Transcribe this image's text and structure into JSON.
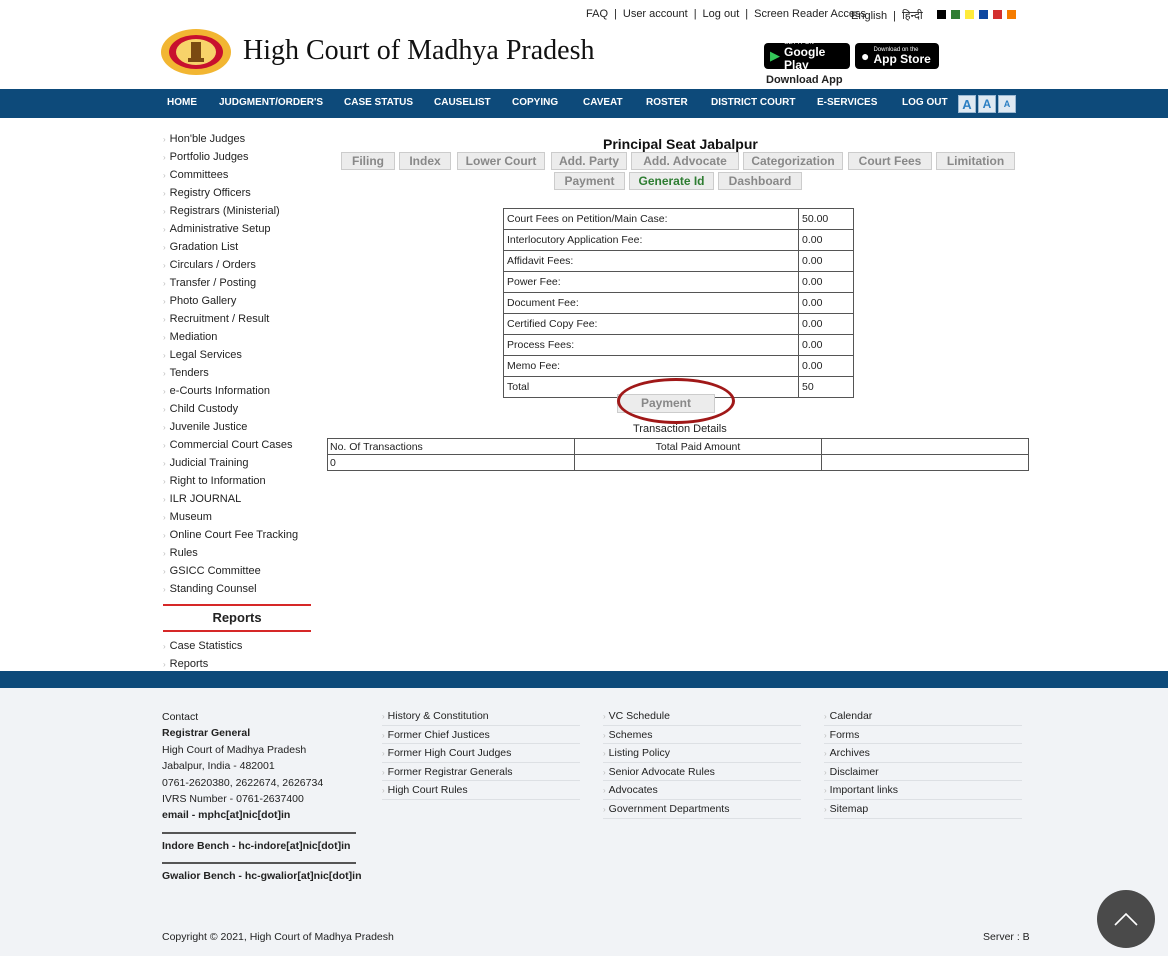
{
  "topbar": {
    "links": [
      "FAQ",
      "User account",
      "Log out",
      "Screen Reader Access"
    ],
    "lang_english": "English",
    "lang_hindi": "हिन्दी",
    "theme_swatches": [
      "#000000",
      "#2e7d32",
      "#ffeb3b",
      "#0d47a1",
      "#d32f2f",
      "#f57c00"
    ]
  },
  "header": {
    "title": "High Court of Madhya Pradesh",
    "google_play_small": "GET IT ON",
    "google_play_big": "Google Play",
    "app_store_small": "Download on the",
    "app_store_big": "App Store",
    "download_label": "Download App"
  },
  "nav": {
    "items": [
      "HOME",
      "JUDGMENT/ORDER'S",
      "CASE STATUS",
      "CAUSELIST",
      "COPYING",
      "CAVEAT",
      "ROSTER",
      "DISTRICT COURT",
      "E-SERVICES",
      "LOG OUT"
    ],
    "font_buttons": [
      "A",
      "A",
      "A"
    ]
  },
  "sidebar": {
    "items": [
      "Hon'ble Judges",
      "Portfolio Judges",
      "Committees",
      "Registry Officers",
      "Registrars (Ministerial)",
      "Administrative Setup",
      "Gradation List",
      "Circulars / Orders",
      "Transfer / Posting",
      "Photo Gallery",
      "Recruitment / Result",
      "Mediation",
      "Legal Services",
      "Tenders",
      "e-Courts Information",
      "Child Custody",
      "Juvenile Justice",
      "Commercial Court Cases",
      "Judicial Training",
      "Right to Information",
      "ILR JOURNAL",
      "Museum",
      "Online Court Fee Tracking",
      "Rules",
      "GSICC Committee",
      "Standing Counsel"
    ],
    "reports_heading": "Reports",
    "report_items": [
      "Case Statistics",
      "Reports"
    ]
  },
  "main": {
    "title": "Principal Seat Jabalpur",
    "tabs": [
      "Filing",
      "Index",
      "Lower Court",
      "Add. Party",
      "Add. Advocate",
      "Categorization",
      "Court Fees",
      "Limitation",
      "Payment",
      "Generate Id",
      "Dashboard"
    ],
    "fees": [
      {
        "label": "Court Fees on Petition/Main Case:",
        "value": "50.00"
      },
      {
        "label": "Interlocutory Application Fee:",
        "value": "0.00"
      },
      {
        "label": "Affidavit Fees:",
        "value": "0.00"
      },
      {
        "label": "Power Fee:",
        "value": "0.00"
      },
      {
        "label": "Document Fee:",
        "value": "0.00"
      },
      {
        "label": "Certified Copy Fee:",
        "value": "0.00"
      },
      {
        "label": "Process Fees:",
        "value": "0.00"
      },
      {
        "label": "Memo Fee:",
        "value": "0.00"
      },
      {
        "label": "Total",
        "value": "50"
      }
    ],
    "payment_button": "Payment",
    "transaction_title": "Transaction Details",
    "tx_headers": [
      "No. Of Transactions",
      "Total Paid Amount"
    ],
    "tx_row": [
      "0",
      ""
    ]
  },
  "footer": {
    "contact_label": "Contact",
    "registrar": "Registrar General",
    "address1": "High Court of Madhya Pradesh",
    "address2": "Jabalpur, India - 482001",
    "phones": "0761-2620380, 2622674, 2626734",
    "ivrs": "IVRS Number - 0761-2637400",
    "email": "email - mphc[at]nic[dot]in",
    "indore": "Indore Bench - hc-indore[at]nic[dot]in",
    "gwalior": "Gwalior Bench - hc-gwalior[at]nic[dot]in",
    "col1": [
      "History & Constitution",
      "Former Chief Justices",
      "Former High Court Judges",
      "Former Registrar Generals",
      "High Court Rules"
    ],
    "col2": [
      "VC Schedule",
      "Schemes",
      "Listing Policy",
      "Senior Advocate Rules",
      "Advocates",
      "Government Departments"
    ],
    "col3": [
      "Calendar",
      "Forms",
      "Archives",
      "Disclaimer",
      "Important links",
      "Sitemap"
    ],
    "copyright": "Copyright © 2021, High Court of Madhya Pradesh",
    "server": "Server : B"
  }
}
